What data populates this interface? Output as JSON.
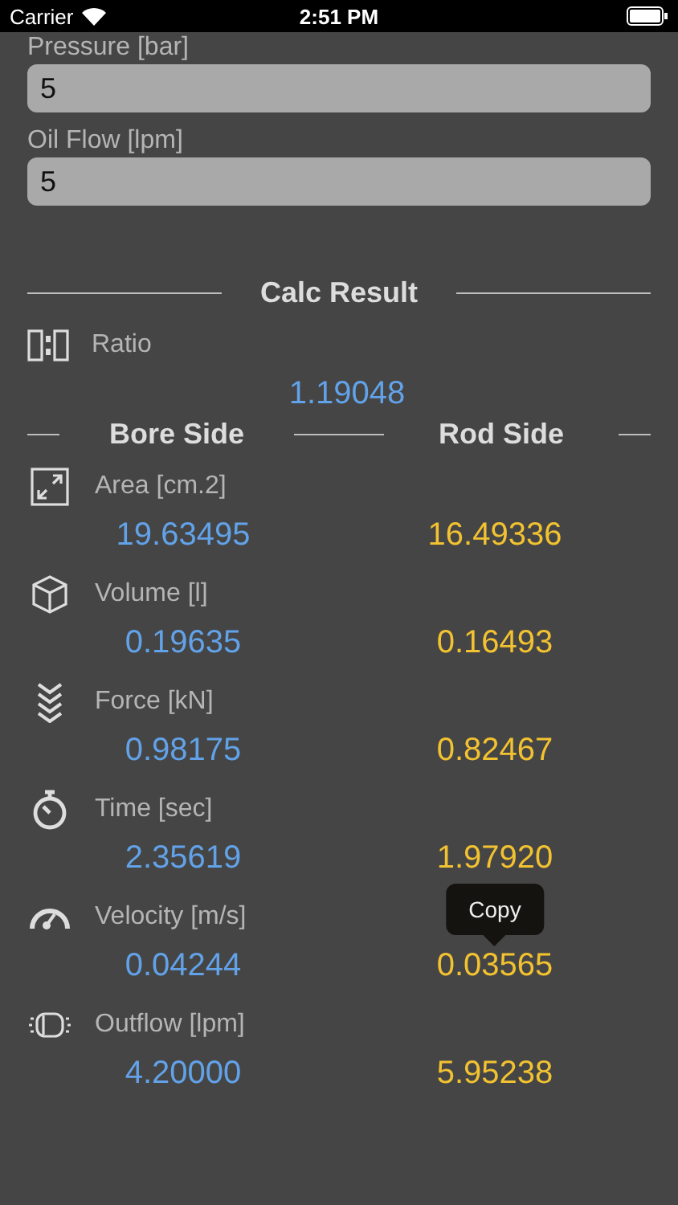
{
  "status_bar": {
    "carrier": "Carrier",
    "time": "2:51 PM"
  },
  "inputs": [
    {
      "label": "Pressure [bar]",
      "value": "5"
    },
    {
      "label": "Oil Flow [lpm]",
      "value": "5"
    }
  ],
  "result": {
    "title": "Calc Result",
    "ratio": {
      "label": "Ratio",
      "value": "1.19048"
    },
    "columns": [
      "Bore Side",
      "Rod Side"
    ],
    "metrics": [
      {
        "kind": "area",
        "label": "Area [cm.2]",
        "bore": "19.63495",
        "rod": "16.49336"
      },
      {
        "kind": "volume",
        "label": "Volume  [l]",
        "bore": "0.19635",
        "rod": "0.16493"
      },
      {
        "kind": "force",
        "label": "Force [kN]",
        "bore": "0.98175",
        "rod": "0.82467"
      },
      {
        "kind": "time",
        "label": "Time [sec]",
        "bore": "2.35619",
        "rod": "1.97920"
      },
      {
        "kind": "velocity",
        "label": "Velocity [m/s]",
        "bore": "0.04244",
        "rod": "0.03565"
      },
      {
        "kind": "outflow",
        "label": "Outflow [lpm]",
        "bore": "4.20000",
        "rod": "5.95238"
      }
    ]
  },
  "tooltip": {
    "label": "Copy"
  }
}
